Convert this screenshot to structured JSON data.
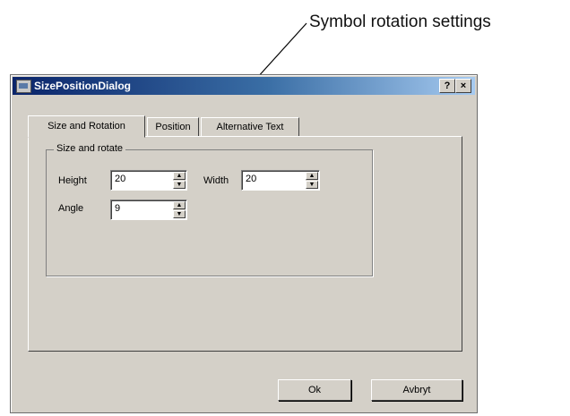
{
  "callout": {
    "text": "Symbol rotation settings"
  },
  "dialog": {
    "title": "SizePositionDialog",
    "help_button": "?",
    "close_button": "×",
    "tabs": [
      {
        "label": "Size and Rotation",
        "active": true
      },
      {
        "label": "Position",
        "active": false
      },
      {
        "label": "Alternative Text",
        "active": false
      }
    ],
    "group": {
      "legend": "Size and rotate",
      "height_label": "Height",
      "height_value": "20",
      "width_label": "Width",
      "width_value": "20",
      "angle_label": "Angle",
      "angle_value": "9"
    },
    "ok_label": "Ok",
    "cancel_label": "Avbryt"
  },
  "icons": {
    "app": "dialog-app-icon",
    "spin_up": "spin-up-arrow-icon",
    "spin_down": "spin-down-arrow-icon"
  },
  "colors": {
    "window_face": "#d4d0c8",
    "title_bar_start": "#0a246a",
    "title_bar_end": "#a6caf0"
  }
}
